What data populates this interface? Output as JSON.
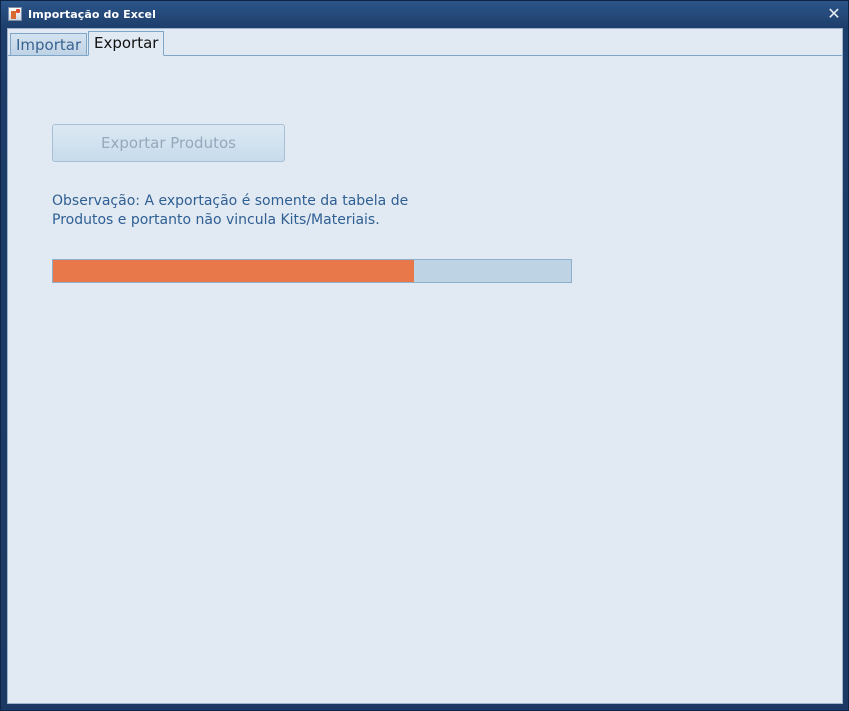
{
  "window": {
    "title": "Importação do Excel",
    "close_glyph": "✕",
    "icon": "excel-app-icon"
  },
  "tabs": [
    {
      "label": "Importar",
      "selected": false
    },
    {
      "label": "Exportar",
      "selected": true
    }
  ],
  "export": {
    "button_label": "Exportar Produtos",
    "button_enabled": false,
    "note_line1": "Observação: A exportação é somente da tabela de",
    "note_line2": "Produtos e portanto não vincula Kits/Materiais.",
    "progress_fraction": 0.696
  },
  "colors": {
    "progress_fill": "#e8784a",
    "progress_track": "#bed4e4",
    "note_text": "#2f5f93",
    "window_frame": "#1d3d6a"
  }
}
